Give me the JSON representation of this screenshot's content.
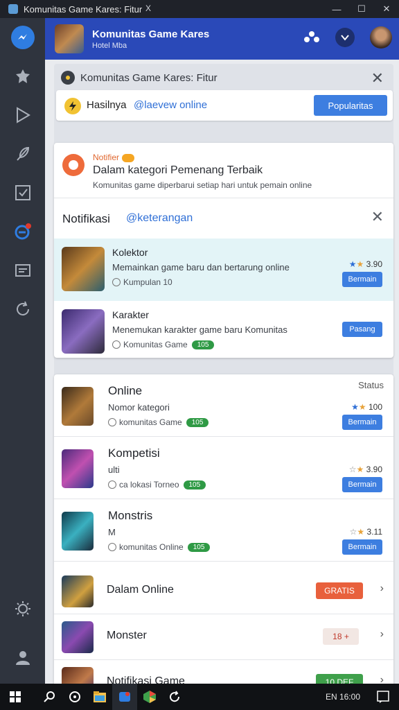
{
  "window": {
    "title": "Komunitas Game Kares: Fitur",
    "tab_close": "X",
    "minimize": "—",
    "maximize": "☐",
    "close": "✕"
  },
  "sidebar": {
    "items": [
      {
        "icon": "messenger-logo-icon"
      },
      {
        "icon": "puzzle-icon"
      },
      {
        "icon": "play-icon"
      },
      {
        "icon": "feather-icon"
      },
      {
        "icon": "checkbox-icon"
      },
      {
        "icon": "notification-link-icon"
      },
      {
        "icon": "message-card-icon"
      },
      {
        "icon": "refresh-icon"
      },
      {
        "icon": "settings-sun-icon"
      },
      {
        "icon": "user-icon"
      }
    ]
  },
  "header": {
    "name": "Komunitas Game Kares",
    "sub": "Hotel Mba"
  },
  "panel": {
    "title": "Komunitas Game Kares: Fitur",
    "close": "✕"
  },
  "tabs": {
    "label1": "Hasilnya",
    "label2": "@laevew online",
    "button": "Popularitas"
  },
  "notification": {
    "label": "Notifier",
    "title": "Dalam kategori Pemenang Terbaik",
    "subtitle": "Komunitas game diperbarui setiap hari untuk pemain online"
  },
  "section": {
    "title": "Notifikasi",
    "link": "@keterangan",
    "close": "✕"
  },
  "featured": [
    {
      "name": "Kolektor",
      "desc": "Memainkan game baru dan bertarung online",
      "meta": "Kumpulan 10",
      "rating": "3.90",
      "button": "Bermain",
      "highlight": true
    },
    {
      "name": "Karakter",
      "desc": "Menemukan karakter game baru Komunitas",
      "meta": "Komunitas Game",
      "pill": "105",
      "button": "Pasang",
      "highlight": false
    }
  ],
  "games_header": "Status",
  "games": [
    {
      "name": "Online",
      "desc": "Nomor kategori",
      "meta": "komunitas Game",
      "pill": "105",
      "rating": "100",
      "button": "Bermain"
    },
    {
      "name": "Kompetisi",
      "desc": "ulti",
      "meta": "ca lokasi Torneo",
      "pill": "105",
      "rating": "3.90",
      "button": "Bermain"
    },
    {
      "name": "Monstris",
      "desc": "M",
      "meta": "komunitas Online",
      "pill": "105",
      "rating": "3.11",
      "button": "Bermain"
    }
  ],
  "simple_rows": [
    {
      "name": "Dalam Online",
      "badge": "GRATIS",
      "color": "#e8603c"
    },
    {
      "name": "Monster",
      "badge": "18 +",
      "color": "#f2e7e3",
      "text_color": "#c0392b"
    },
    {
      "name": "Notifikasi Game",
      "badge": "10 DEF",
      "color": "#3fa04b"
    }
  ],
  "taskbar": {
    "tray": "EN 16:00",
    "icons": [
      "windows-start-icon",
      "search-icon",
      "settings-icon",
      "file-explorer-icon",
      "messenger-icon",
      "maps-icon",
      "sync-icon"
    ]
  },
  "colors": {
    "accent": "#3d7ee0",
    "header": "#2a49b8",
    "sidebar": "#2f343e"
  }
}
